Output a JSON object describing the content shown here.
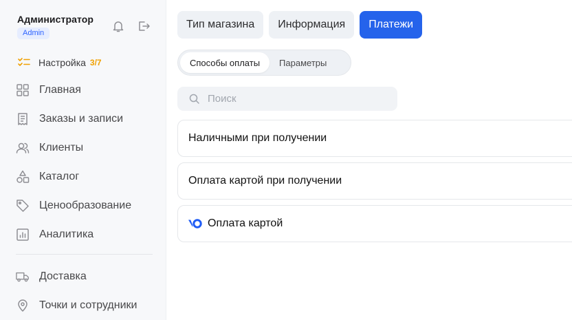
{
  "user": {
    "name": "Администратор",
    "role_badge": "Admin"
  },
  "setup": {
    "label": "Настройка",
    "progress": "3/7"
  },
  "sidebar": {
    "items": [
      {
        "label": "Главная",
        "icon": "grid-icon"
      },
      {
        "label": "Заказы и записи",
        "icon": "receipt-icon"
      },
      {
        "label": "Клиенты",
        "icon": "users-icon"
      },
      {
        "label": "Каталог",
        "icon": "shapes-icon"
      },
      {
        "label": "Ценообразование",
        "icon": "tag-icon"
      },
      {
        "label": "Аналитика",
        "icon": "chart-icon"
      },
      {
        "label": "Доставка",
        "icon": "truck-icon"
      },
      {
        "label": "Точки и сотрудники",
        "icon": "location-pin-icon"
      }
    ]
  },
  "tabs": [
    {
      "label": "Тип магазина",
      "active": false
    },
    {
      "label": "Информация",
      "active": false
    },
    {
      "label": "Платежи",
      "active": true
    }
  ],
  "segments": [
    {
      "label": "Способы оплаты",
      "active": true
    },
    {
      "label": "Параметры",
      "active": false
    }
  ],
  "search": {
    "placeholder": "Поиск"
  },
  "payment_methods": [
    {
      "label": "Наличными при получении"
    },
    {
      "label": "Оплата картой при получении"
    },
    {
      "label": "Оплата картой",
      "logo": "yookassa-logo-icon"
    }
  ],
  "colors": {
    "accent": "#2563eb",
    "badge_text": "#2d63ff",
    "progress": "#f0a000"
  }
}
